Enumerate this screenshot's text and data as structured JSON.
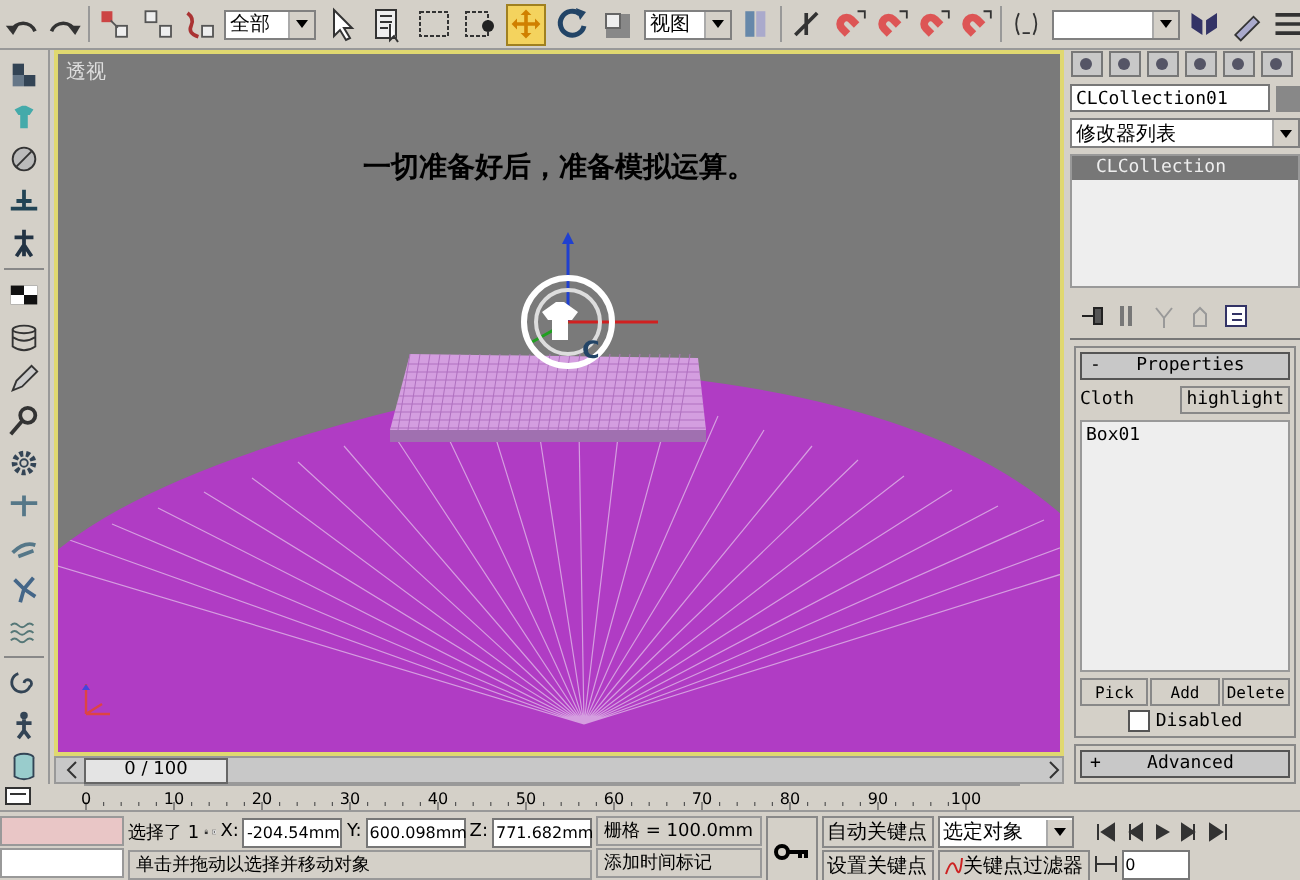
{
  "toolbar": {
    "selection_filter": "全部",
    "coordinate_system": "视图",
    "tools": [
      {
        "kind": "select",
        "selected": false
      },
      {
        "kind": "select-by-name",
        "selected": false
      },
      {
        "kind": "region",
        "selected": false
      },
      {
        "kind": "window",
        "selected": false
      },
      {
        "kind": "move",
        "selected": true
      },
      {
        "kind": "rotate",
        "selected": false
      },
      {
        "kind": "scale",
        "selected": false
      }
    ]
  },
  "viewport": {
    "label": "透视",
    "caption": "一切准备好后，准备模拟运算。",
    "helper_mark": "C"
  },
  "time_slider": {
    "label": "0 / 100",
    "level": 0
  },
  "track_bar": {
    "ticks": [
      "0",
      "10",
      "20",
      "30",
      "40",
      "50",
      "60",
      "70",
      "80",
      "90",
      "100"
    ]
  },
  "command_panel": {
    "object_name": "CLCollection01",
    "modifier_list": "修改器列表",
    "stack": [
      {
        "label": "CLCollection",
        "selected": true
      }
    ],
    "properties": {
      "toggle": "-",
      "title": "Properties",
      "cloth_label": "Cloth",
      "highlight_button": "highlight",
      "objects": [
        "Box01"
      ],
      "buttons": [
        "Pick",
        "Add",
        "Delete"
      ],
      "disabled": {
        "label": "Disabled",
        "checked": false
      }
    },
    "advanced": {
      "toggle": "+",
      "title": "Advanced"
    }
  },
  "status": {
    "selection": "选择了 1",
    "coords": [
      {
        "label": "X:",
        "value": "-204.54mm"
      },
      {
        "label": "Y:",
        "value": "600.098mm"
      },
      {
        "label": "Z:",
        "value": "771.682mm"
      }
    ],
    "grid": "栅格 = 100.0mm",
    "auto_key": "自动关键点",
    "key_mode": "选定对象",
    "set_key": "设置关键点",
    "key_filters": "关键点过滤器",
    "prompt": "单击并拖动以选择并移动对象",
    "time_tag": "添加时间标记",
    "frame": "0"
  }
}
